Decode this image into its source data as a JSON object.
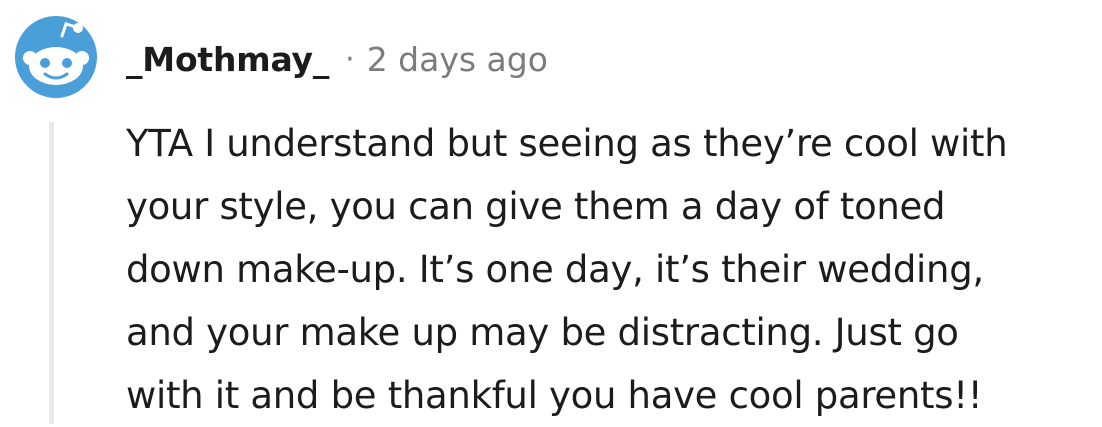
{
  "comment": {
    "author": "_Mothmay_",
    "separator": "·",
    "timestamp": "2 days ago",
    "avatar_icon": "snoo-avatar-icon",
    "body_lines": [
      "YTA I understand but seeing as they’re cool with",
      "your style, you can give them a day of toned",
      "down make-up. It’s one day, it’s their wedding,",
      "and your make up may be distracting. Just go",
      "with it and be thankful you have cool parents!!"
    ]
  },
  "colors": {
    "avatar_bg": "#4a9fd9",
    "text": "#1c1c1c",
    "muted": "#7c7c7c",
    "thread_line": "#e9e9e9"
  }
}
